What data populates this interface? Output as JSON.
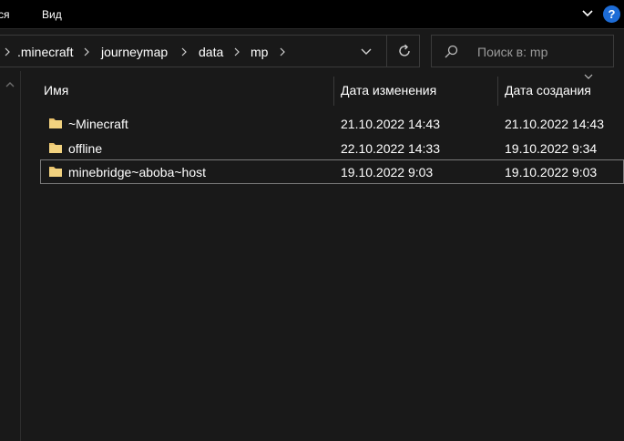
{
  "ribbon": {
    "tabs": [
      {
        "label": "ся"
      },
      {
        "label": "Вид"
      }
    ],
    "help_label": "?"
  },
  "breadcrumb": [
    {
      "label": ".minecraft"
    },
    {
      "label": "journeymap"
    },
    {
      "label": "data"
    },
    {
      "label": "mp"
    }
  ],
  "search": {
    "placeholder": "Поиск в: mp"
  },
  "columns": {
    "name": "Имя",
    "modified": "Дата изменения",
    "created": "Дата создания"
  },
  "files": [
    {
      "name": "~Minecraft",
      "modified": "21.10.2022 14:43",
      "created": "21.10.2022 14:43",
      "selected": false
    },
    {
      "name": "offline",
      "modified": "22.10.2022 14:33",
      "created": "19.10.2022 9:34",
      "selected": false
    },
    {
      "name": "minebridge~aboba~host",
      "modified": "19.10.2022 9:03",
      "created": "19.10.2022 9:03",
      "selected": true
    }
  ],
  "colors": {
    "background": "#191919",
    "folder": "#e8c06a",
    "accent_help": "#1d6cd6"
  }
}
